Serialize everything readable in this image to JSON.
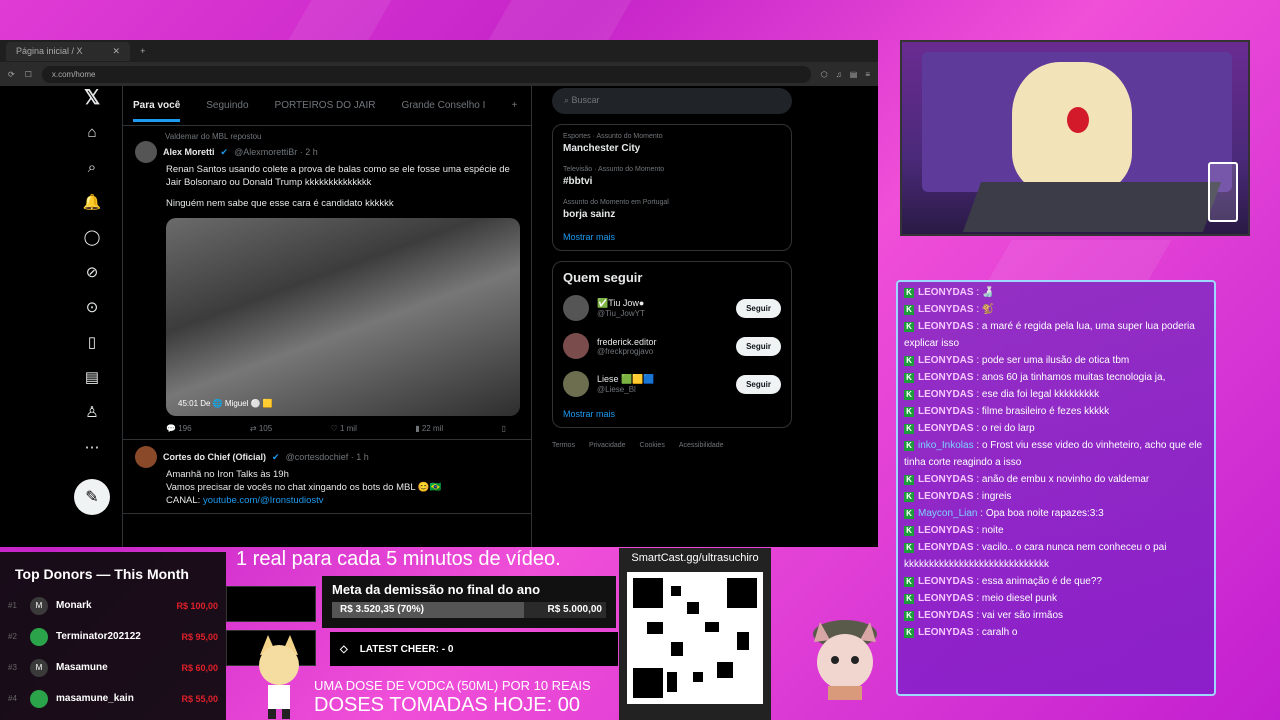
{
  "browser": {
    "tab_title": "Página inicial / X",
    "url": "x.com/home",
    "nav_tabs": [
      "Para você",
      "Seguindo",
      "PORTEIROS DO JAIR",
      "Grande Conselho I"
    ],
    "tweets": [
      {
        "repost": "Valdemar do MBL repostou",
        "name": "Alex Moretti",
        "handle": "@AlexmorettiBr · 2 h",
        "text1": "Renan Santos usando colete a prova de balas como se ele fosse uma espécie de Jair Bolsonaro ou Donald Trump kkkkkkkkkkkkkk",
        "text2": "Ninguém nem sabe que esse cara é candidato kkkkkk",
        "media_caption": "45:01  De 🌐 Miguel ⚪ 🟨",
        "replies": "196",
        "reposts": "105",
        "likes": "1 mil",
        "views": "22 mil"
      },
      {
        "name": "Cortes do Chief (Oficial)",
        "handle": "@cortesdochief · 1 h",
        "text1": "Amanhã no Iron Talks às 19h",
        "text2": "Vamos precisar de vocês no chat xingando os bots do MBL 😊🇧🇷",
        "link_prefix": "CANAL: ",
        "link": "youtube.com/@Ironstudiostv"
      }
    ],
    "search_placeholder": "Buscar",
    "trends": [
      {
        "cat": "Esportes · Assunto do Momento",
        "title": "Manchester City"
      },
      {
        "cat": "Televisão · Assunto do Momento",
        "title": "#bbtvi"
      },
      {
        "cat": "Assunto do Momento em Portugal",
        "title": "borja sainz"
      }
    ],
    "show_more": "Mostrar mais",
    "who_to_follow": "Quem seguir",
    "follow": [
      {
        "name": "✅Tiu Jow●",
        "handle": "@Tiu_JowYT"
      },
      {
        "name": "frederick.editor",
        "handle": "@freckprogjavo"
      },
      {
        "name": "Liese 🟩🟨🟦",
        "handle": "@Liese_Bl"
      }
    ],
    "follow_label": "Seguir",
    "footer": [
      "Termos",
      "Privacidade",
      "Cookies",
      "Acessibilidade"
    ]
  },
  "chat": [
    {
      "user": "LEONYDAS",
      "text": "🍶"
    },
    {
      "user": "LEONYDAS",
      "text": "🐒"
    },
    {
      "user": "LEONYDAS",
      "text": "a maré é regida pela lua, uma super lua poderia explicar isso"
    },
    {
      "user": "LEONYDAS",
      "text": "pode ser uma ilusão de otica tbm"
    },
    {
      "user": "LEONYDAS",
      "text": "anos 60 ja tinhamos muitas tecnologia ja,"
    },
    {
      "user": "LEONYDAS",
      "text": "ese dia foi legal kkkkkkkkk"
    },
    {
      "user": "LEONYDAS",
      "text": "filme brasileiro é fezes kkkkk"
    },
    {
      "user": "LEONYDAS",
      "text": "o rei do larp"
    },
    {
      "user": "inko_Inkolas",
      "text": "o Frost viu esse video do vinheteiro, acho que ele tinha corte reagindo a isso",
      "alt": true
    },
    {
      "user": "LEONYDAS",
      "text": "anão de embu x novinho do valdemar"
    },
    {
      "user": "LEONYDAS",
      "text": "ingreis"
    },
    {
      "user": "Maycon_Lian",
      "text": "Opa boa noite rapazes:3:3",
      "alt": true
    },
    {
      "user": "LEONYDAS",
      "text": "noite"
    },
    {
      "user": "LEONYDAS",
      "text": "vacilo.. o cara nunca nem conheceu o pai kkkkkkkkkkkkkkkkkkkkkkkkkkkkk"
    },
    {
      "user": "LEONYDAS",
      "text": "essa animação é de que??"
    },
    {
      "user": "LEONYDAS",
      "text": "meio diesel punk"
    },
    {
      "user": "LEONYDAS",
      "text": "vai ver são irmãos"
    },
    {
      "user": "LEONYDAS",
      "text": "caralh o"
    }
  ],
  "donors": {
    "title": "Top Donors — This Month",
    "list": [
      {
        "rank": "#1",
        "initial": "M",
        "name": "Monark",
        "amount": "R$ 100,00"
      },
      {
        "rank": "#2",
        "initial": "",
        "name": "Terminator202122",
        "amount": "R$ 95,00"
      },
      {
        "rank": "#3",
        "initial": "M",
        "name": "Masamune",
        "amount": "R$ 60,00"
      },
      {
        "rank": "#4",
        "initial": "",
        "name": "masamune_kain",
        "amount": "R$ 55,00"
      }
    ]
  },
  "ticker": "1 real para cada 5 minutos de vídeo.",
  "goal": {
    "title": "Meta da demissão no final do ano",
    "current": "R$ 3.520,35 (70%)",
    "target": "R$ 5.000,00",
    "progress": 0.7
  },
  "cheer": "LATEST CHEER: - 0",
  "dose_line1": "UMA DOSE DE VODCA (50ML) POR 10 REAIS",
  "dose_line2": "DOSES TOMADAS HOJE: 00",
  "qr_url": "SmartCast.gg/ultrasuchiro",
  "colors": {
    "x_blue": "#1d9bf0",
    "chat_border": "#9ed8ff",
    "donor_amount": "#e0202a"
  }
}
